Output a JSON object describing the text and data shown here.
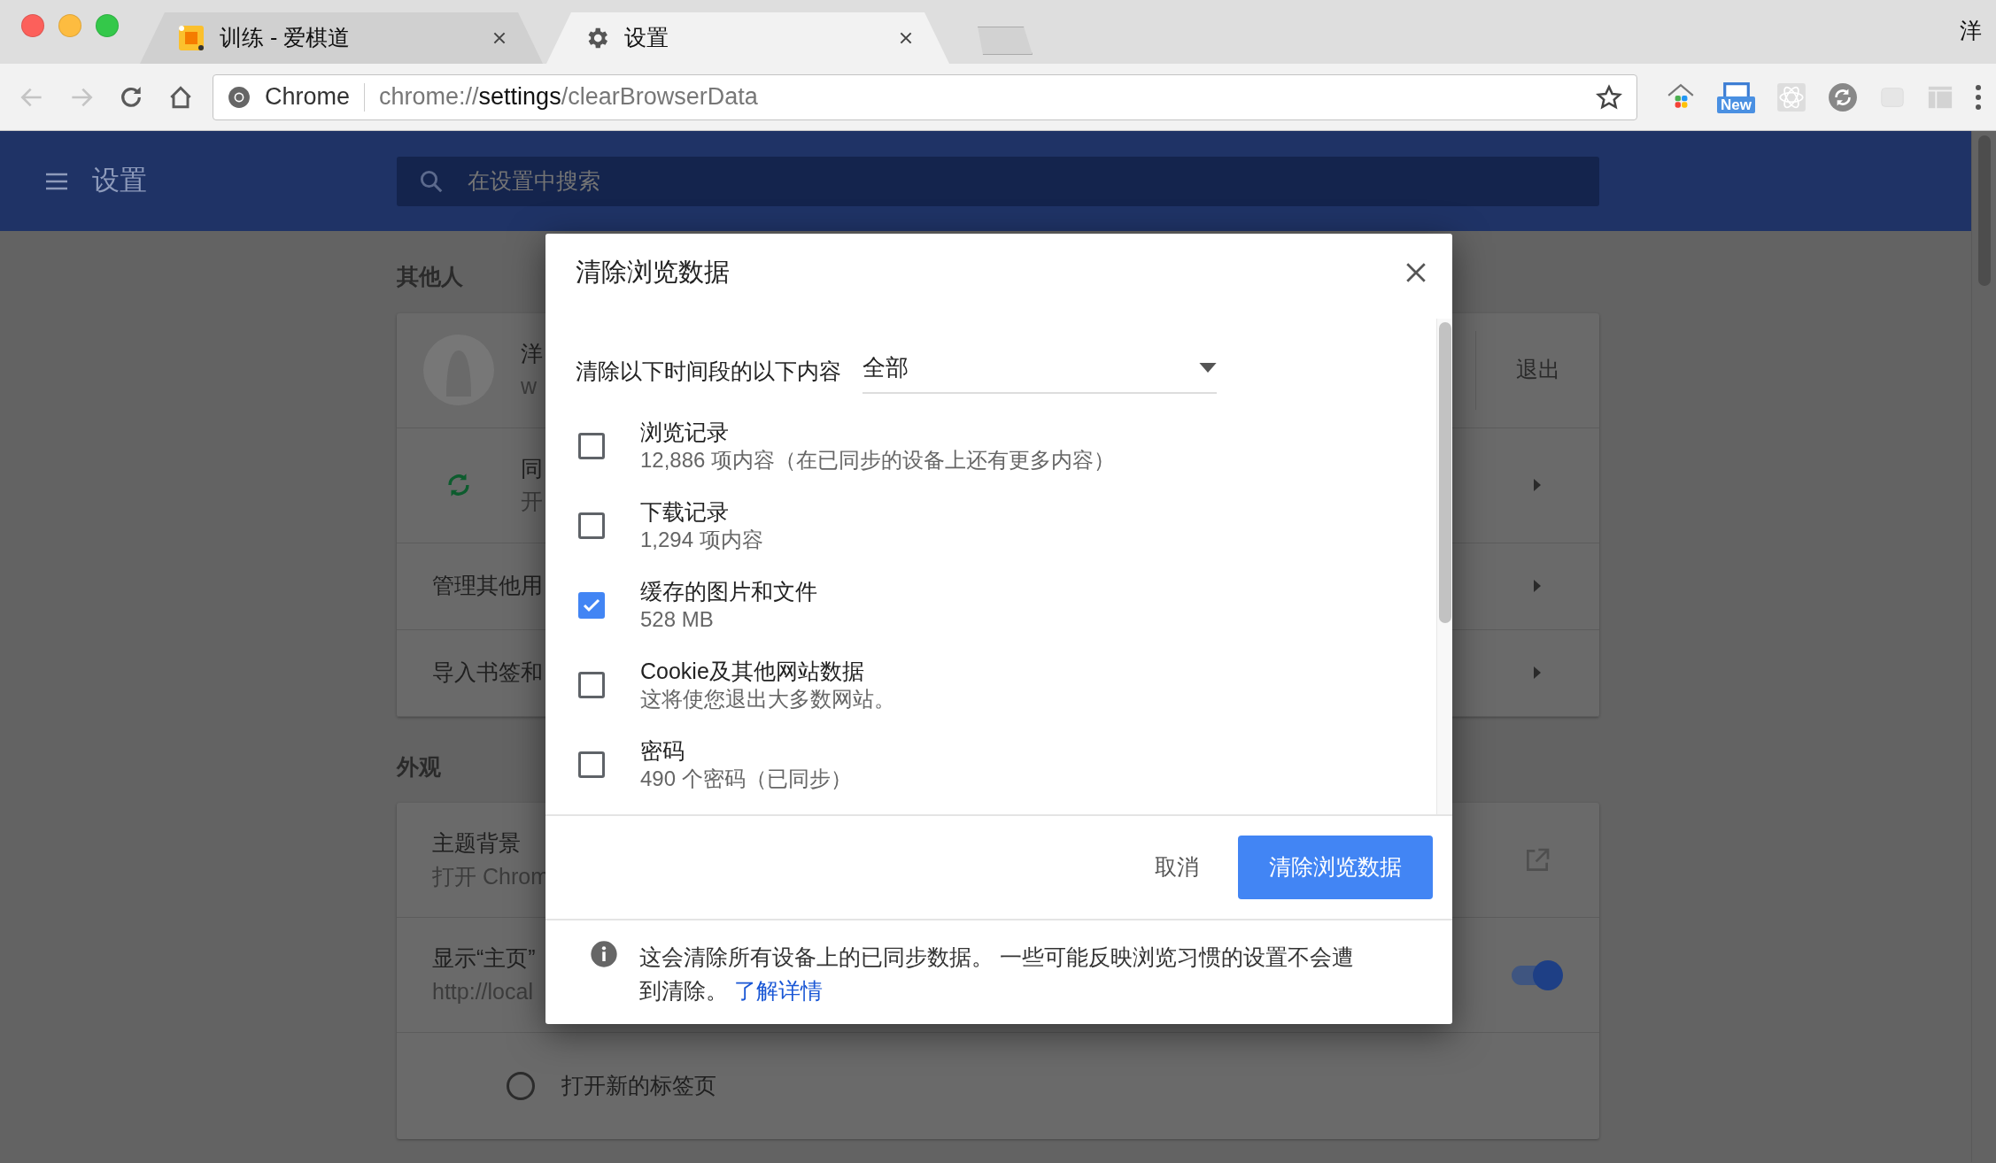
{
  "browser": {
    "tabs": [
      {
        "title": "训练 - 爱棋道",
        "kind": "site",
        "selected": false
      },
      {
        "title": "设置",
        "kind": "settings",
        "selected": true
      }
    ],
    "profile": "洋",
    "nav_buttons": [
      {
        "kind": "back",
        "disabled": true
      },
      {
        "kind": "forward",
        "disabled": true
      },
      {
        "kind": "reload",
        "disabled": false
      },
      {
        "kind": "home",
        "disabled": false
      }
    ],
    "address": {
      "chip": "Chrome",
      "url_scheme": "chrome://",
      "url_host": "settings",
      "url_path": "/clearBrowserData"
    },
    "extensions": [
      {
        "kind": "house"
      },
      {
        "kind": "screen",
        "badge": "New"
      },
      {
        "kind": "atom"
      },
      {
        "kind": "refresh"
      },
      {
        "kind": "key"
      },
      {
        "kind": "layout"
      }
    ]
  },
  "settings": {
    "title": "设置",
    "search_placeholder": "在设置中搜索",
    "sections": [
      {
        "heading": "其他人",
        "rows": [
          {
            "kind": "profile",
            "title": "洋",
            "subtitle": "w",
            "action": "退出"
          },
          {
            "kind": "sync",
            "title": "同",
            "subtitle": "开"
          },
          {
            "kind": "link",
            "title": "管理其他用"
          },
          {
            "kind": "link",
            "title": "导入书签和"
          }
        ]
      },
      {
        "heading": "外观",
        "rows": [
          {
            "kind": "external",
            "title": "主题背景",
            "subtitle": "打开 Chrom"
          },
          {
            "kind": "toggle",
            "title": "显示“主页”",
            "subtitle": "http://local",
            "on": true
          },
          {
            "kind": "radio",
            "title": "打开新的标签页",
            "selected": false
          }
        ]
      }
    ]
  },
  "dialog": {
    "title": "清除浏览数据",
    "range_label": "清除以下时间段的以下内容",
    "range_value": "全部",
    "items": [
      {
        "title": "浏览记录",
        "detail": "12,886 项内容（在已同步的设备上还有更多内容）",
        "checked": false
      },
      {
        "title": "下载记录",
        "detail": "1,294 项内容",
        "checked": false
      },
      {
        "title": "缓存的图片和文件",
        "detail": "528 MB",
        "checked": true
      },
      {
        "title": "Cookie及其他网站数据",
        "detail": "这将使您退出大多数网站。",
        "checked": false
      },
      {
        "title": "密码",
        "detail": "490 个密码（已同步）",
        "checked": false
      }
    ],
    "cancel": "取消",
    "confirm": "清除浏览数据",
    "notice": "这会清除所有设备上的已同步数据。 一些可能反映浏览习惯的设置不会遭到清除。",
    "link": "了解详情"
  }
}
